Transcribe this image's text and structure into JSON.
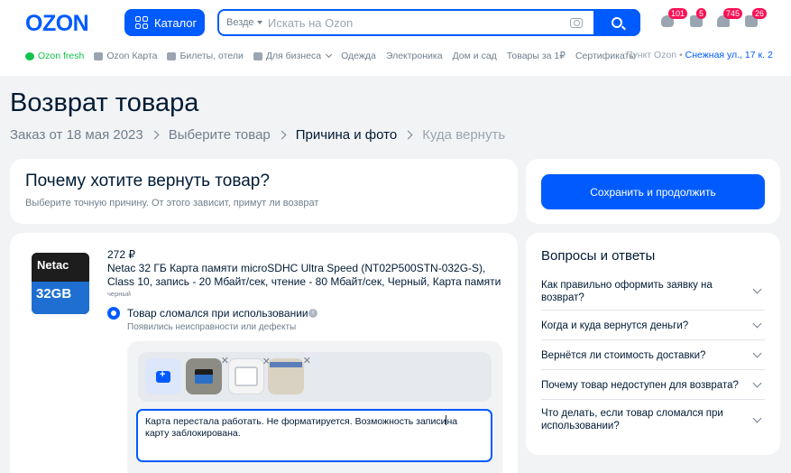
{
  "header": {
    "logo": "OZON",
    "catalog_label": "Каталог",
    "search": {
      "scope": "Везде",
      "placeholder": "Искать на Ozon"
    },
    "badges": {
      "profile": "101",
      "orders": "5",
      "favorites": "745",
      "cart": "26"
    }
  },
  "nav": {
    "items": [
      "Ozon fresh",
      "Ozon Карта",
      "Билеты, отели",
      "Для бизнеса",
      "Одежда",
      "Электроника",
      "Дом и сад",
      "Товары за 1₽",
      "Сертификаты"
    ],
    "pickup_label": "Пункт Ozon",
    "address": "Снежная ул., 17 к. 2"
  },
  "page": {
    "title": "Возврат товара",
    "breadcrumbs": [
      "Заказ от 18 мая 2023",
      "Выберите товар",
      "Причина и фото",
      "Куда вернуть"
    ]
  },
  "reason_card": {
    "title": "Почему хотите вернуть товар?",
    "subtitle": "Выберите точную причину. От этого зависит, примут ли возврат"
  },
  "save_button": "Сохранить и продолжить",
  "item": {
    "image_brand": "Netac",
    "image_capacity": "32GB",
    "price": "272 ₽",
    "name": "Netac 32 ГБ Карта памяти microSDHC Ultra Speed (NT02P500STN-032G-S), Class 10, запись - 20 Мбайт/сек, чтение - 80 Мбайт/сек, Черный, Карта памяти",
    "color": "черный",
    "reason_label": "Товар сломался при использовании",
    "reason_sub": "Появились неисправности или дефекты",
    "comment_before": "Карта перестала работать. Не форматируется. Возможность записи",
    "comment_after": "на карту заблокирована."
  },
  "faq": {
    "title": "Вопросы и ответы",
    "items": [
      "Как правильно оформить заявку на возврат?",
      "Когда и куда вернутся деньги?",
      "Вернётся ли стоимость доставки?",
      "Почему товар недоступен для возврата?",
      "Что делать, если товар сломался при использовании?"
    ]
  },
  "colors": {
    "accent": "#005bff",
    "badge": "#f91155",
    "fresh": "#10c44c",
    "background": "#f2f3f5"
  }
}
